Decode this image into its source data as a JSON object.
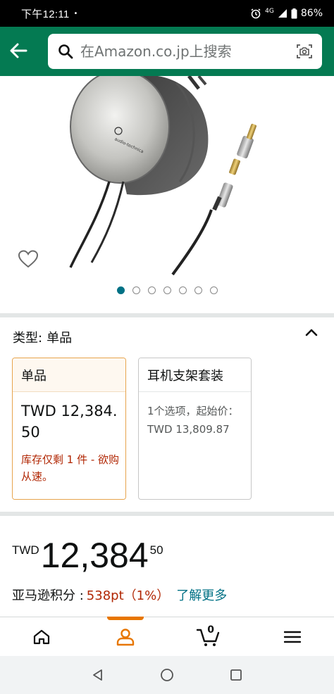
{
  "status_bar": {
    "time": "下午12:11",
    "dot": "•",
    "network": "4G",
    "battery": "86%"
  },
  "header": {
    "search_placeholder": "在Amazon.co.jp上搜索"
  },
  "gallery": {
    "dot_count": 7,
    "active_index": 0
  },
  "variation": {
    "label": "类型:",
    "selected": "单品",
    "options": [
      {
        "title": "单品",
        "price": "TWD 12,384.50",
        "stock": "库存仅剩 1 件 - 欲购从速。"
      },
      {
        "title": "耳机支架套装",
        "info_line1": "1个选项，起始价：",
        "info_line2": "TWD 13,809.87"
      }
    ]
  },
  "price": {
    "currency": "TWD",
    "whole": "12,384",
    "fraction": "50"
  },
  "points": {
    "label": "亚马逊积分 :",
    "value": "538pt（1%）",
    "learn_more": "了解更多"
  },
  "bottom_nav": {
    "cart_count": "0",
    "active": "account",
    "accent_color": "#e77600"
  },
  "colors": {
    "header_bg": "#047a52",
    "link": "#007185",
    "price_red": "#b12704"
  }
}
